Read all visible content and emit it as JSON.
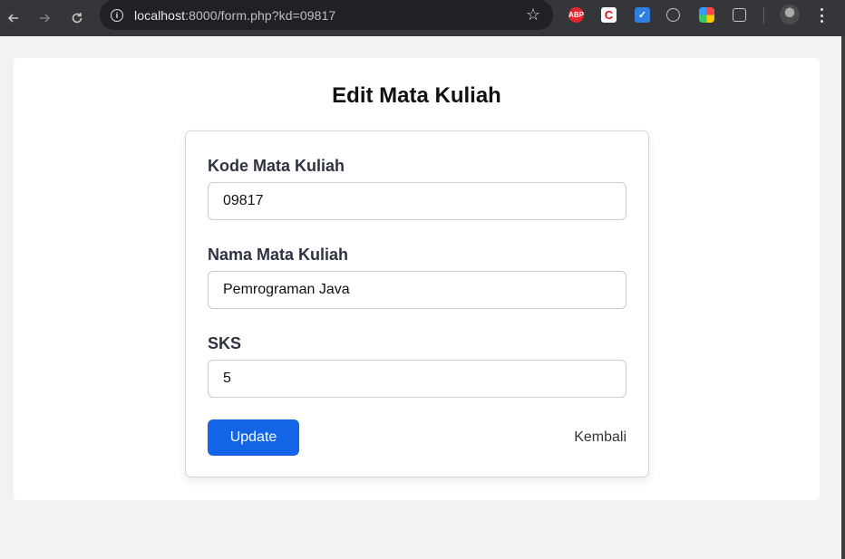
{
  "browser": {
    "url_host": "localhost",
    "url_rest": ":8000/form.php?kd=09817",
    "extensions": [
      {
        "name": "abp-extension-icon",
        "label": "ABP",
        "color": "#e4252d"
      },
      {
        "name": "c-extension-icon",
        "label": "C",
        "color": "#ffffff"
      },
      {
        "name": "check-extension-icon",
        "label": "✓",
        "color": "#2f7fe0"
      },
      {
        "name": "globe-extension-icon",
        "label": "",
        "color": "#c4c7c5"
      },
      {
        "name": "color-extension-icon",
        "label": "",
        "color": "#7a3cf0"
      },
      {
        "name": "puzzle-extension-icon",
        "label": "",
        "color": "#c4c7c5"
      }
    ]
  },
  "page": {
    "title": "Edit Mata Kuliah",
    "form": {
      "kode_label": "Kode Mata Kuliah",
      "kode_value": "09817",
      "nama_label": "Nama Mata Kuliah",
      "nama_value": "Pemrograman Java",
      "sks_label": "SKS",
      "sks_value": "5",
      "update_label": "Update",
      "back_label": "Kembali"
    },
    "colors": {
      "primary": "#1464e6",
      "background": "#f1f2f4"
    }
  }
}
